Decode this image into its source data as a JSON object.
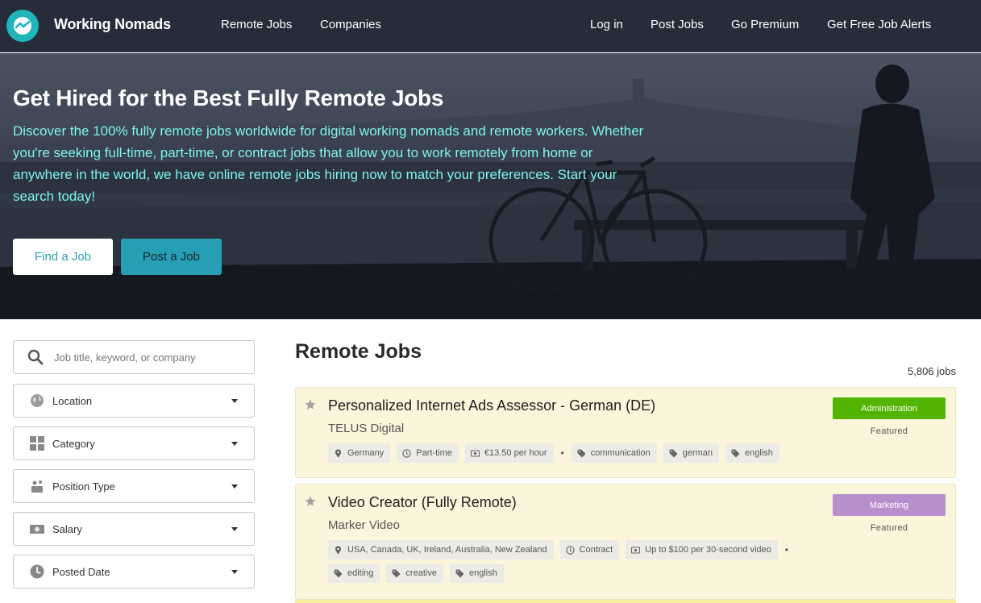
{
  "nav": {
    "brand": "Working Nomads",
    "links_left": [
      "Remote Jobs",
      "Companies"
    ],
    "links_right": [
      "Log in",
      "Post Jobs",
      "Go Premium",
      "Get Free Job Alerts"
    ]
  },
  "hero": {
    "title": "Get Hired for the Best Fully Remote Jobs",
    "description": "Discover the 100% fully remote jobs worldwide for digital working nomads and remote workers. Whether you're seeking full-time, part-time, or contract jobs that allow you to work remotely from home or anywhere in the world, we have online remote jobs hiring now to match your preferences. Start your search today!",
    "find_button": "Find a Job",
    "post_button": "Post a Job"
  },
  "filters": {
    "search_placeholder": "Job title, keyword, or company",
    "items": [
      {
        "label": "Location",
        "icon": "globe-icon"
      },
      {
        "label": "Category",
        "icon": "grid-icon"
      },
      {
        "label": "Position Type",
        "icon": "position-icon"
      },
      {
        "label": "Salary",
        "icon": "money-icon"
      },
      {
        "label": "Posted Date",
        "icon": "clock-icon"
      }
    ]
  },
  "main": {
    "title": "Remote Jobs",
    "count": "5,806 jobs"
  },
  "jobs": [
    {
      "title": "Personalized Internet Ads Assessor - German (DE)",
      "company": "TELUS Digital",
      "category": "Administration",
      "category_color": "#52b400",
      "featured": "Featured",
      "location": "Germany",
      "type": "Part-time",
      "salary": "€13.50 per hour",
      "tags": [
        "communication",
        "german",
        "english"
      ]
    },
    {
      "title": "Video Creator (Fully Remote)",
      "company": "Marker Video",
      "category": "Marketing",
      "category_color": "#b78fcd",
      "featured": "Featured",
      "location": "USA, Canada, UK, Ireland, Australia, New Zealand",
      "type": "Contract",
      "salary": "Up to $100 per 30-second video",
      "tags": [
        "editing",
        "creative",
        "english"
      ]
    }
  ]
}
